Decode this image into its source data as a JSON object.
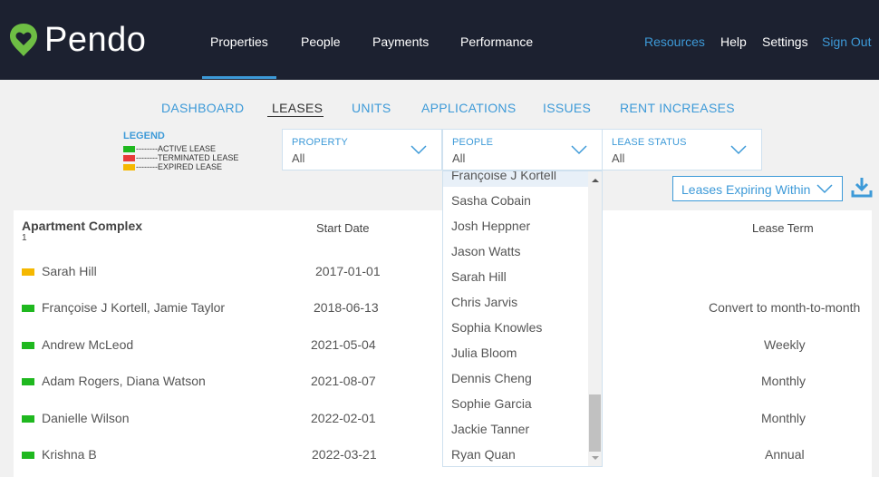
{
  "app": {
    "name": "Pendo"
  },
  "nav": {
    "properties": "Properties",
    "people": "People",
    "payments": "Payments",
    "performance": "Performance"
  },
  "right_nav": {
    "resources": "Resources",
    "help": "Help",
    "settings": "Settings",
    "sign_out": "Sign Out"
  },
  "tabs": {
    "dashboard": "DASHBOARD",
    "leases": "LEASES",
    "units": "UNITS",
    "applications": "APPLICATIONS",
    "issues": "ISSUES",
    "rent_increases": "RENT INCREASES"
  },
  "legend": {
    "title": "LEGEND",
    "active": "--------ACTIVE LEASE",
    "terminated": "--------TERMINATED LEASE",
    "expired": "--------EXPIRED LEASE"
  },
  "filters": {
    "property": {
      "label": "PROPERTY",
      "value": "All"
    },
    "people": {
      "label": "PEOPLE",
      "value": "All"
    },
    "lease_status": {
      "label": "LEASE STATUS",
      "value": "All"
    }
  },
  "people_dropdown": [
    "Françoise J Kortell",
    "Sasha Cobain",
    "Josh Heppner",
    "Jason Watts",
    "Sarah Hill",
    "Chris Jarvis",
    "Sophia Knowles",
    "Julia Bloom",
    "Dennis Cheng",
    "Sophie Garcia",
    "Jackie Tanner",
    "Ryan Quan"
  ],
  "expiring_filter": "Leases Expiring Within",
  "table": {
    "group_title": "Apartment Complex",
    "group_count": "1",
    "col_start": "Start Date",
    "col_term": "Lease Term",
    "rows": [
      {
        "status": "expired",
        "name": "Sarah Hill",
        "start": "2017-01-01",
        "term": ""
      },
      {
        "status": "active",
        "name": "Françoise J Kortell, Jamie Taylor",
        "start": "2018-06-13",
        "term": "Convert to month-to-month"
      },
      {
        "status": "active",
        "name": "Andrew McLeod",
        "start": "2021-05-04",
        "term": "Weekly"
      },
      {
        "status": "active",
        "name": "Adam Rogers, Diana Watson",
        "start": "2021-08-07",
        "term": "Monthly"
      },
      {
        "status": "active",
        "name": "Danielle Wilson",
        "start": "2022-02-01",
        "term": "Monthly"
      },
      {
        "status": "active",
        "name": "Krishna B",
        "start": "2022-03-21",
        "term": "Annual"
      }
    ]
  },
  "colors": {
    "active": "#1fb81f",
    "terminated": "#e83a3a",
    "expired": "#f5b800",
    "accent": "#3d9ad8",
    "nav_bg": "#1c2130"
  },
  "icons": {
    "logo": "heart-pin-icon",
    "chevron": "chevron-down-icon",
    "download": "download-icon"
  }
}
